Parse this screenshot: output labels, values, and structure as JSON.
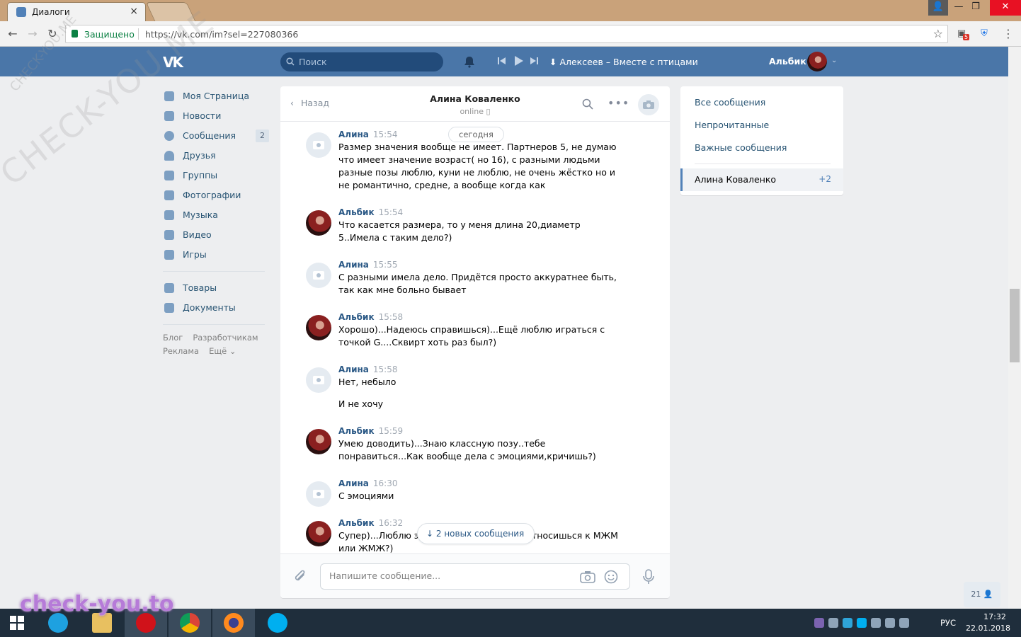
{
  "browser": {
    "tab_title": "Диалоги",
    "tab_close": "×",
    "secure_label": "Защищено",
    "url": "https://vk.com/im?sel=227080366",
    "ext_badge": "5"
  },
  "header": {
    "logo": "VK",
    "search_placeholder": "Поиск",
    "track": "Алексеев – Вместе с птицами",
    "user_name": "Альбик"
  },
  "sidebar": {
    "items": [
      {
        "label": "Моя Страница",
        "icon": "home-icon"
      },
      {
        "label": "Новости",
        "icon": "news-icon"
      },
      {
        "label": "Сообщения",
        "icon": "messages-icon",
        "count": "2"
      },
      {
        "label": "Друзья",
        "icon": "friends-icon"
      },
      {
        "label": "Группы",
        "icon": "groups-icon"
      },
      {
        "label": "Фотографии",
        "icon": "photos-icon"
      },
      {
        "label": "Музыка",
        "icon": "music-icon"
      },
      {
        "label": "Видео",
        "icon": "video-icon"
      },
      {
        "label": "Игры",
        "icon": "games-icon"
      }
    ],
    "items2": [
      {
        "label": "Товары",
        "icon": "goods-icon"
      },
      {
        "label": "Документы",
        "icon": "documents-icon"
      }
    ],
    "footer": [
      "Блог",
      "Разработчикам",
      "Реклама",
      "Ещё ⌄"
    ]
  },
  "chat": {
    "back_label": "Назад",
    "peer_name": "Алина Коваленко",
    "peer_status": "online",
    "date_pill": "сегодня",
    "new_messages": "2 новых сообщения",
    "input_placeholder": "Напишите сообщение...",
    "messages": [
      {
        "author": "Алина",
        "time": "15:54",
        "text": "Размер значения вообще не имеет. Партнеров 5, не думаю что имеет значение возраст( но 16), с разными людьми разные позы люблю, куни не люблю, не очень жёстко но и не романтично, средне, а вообще когда как"
      },
      {
        "author": "Альбик",
        "time": "15:54",
        "text": "Что касается размера, то у меня длина 20,диаметр 5..Имела с таким дело?)"
      },
      {
        "author": "Алина",
        "time": "15:55",
        "text": "С разными имела дело. Придётся просто аккуратнее быть, так как мне больно бывает"
      },
      {
        "author": "Альбик",
        "time": "15:58",
        "text": "Хорошо)...Надеюсь справишься)...Ещё люблю играться с точкой G....Сквирт хоть раз был?)"
      },
      {
        "author": "Алина",
        "time": "15:58",
        "text": "Нет, небыло",
        "text2": "И не хочу"
      },
      {
        "author": "Альбик",
        "time": "15:59",
        "text": "Умею доводить)...Знаю классную позу..тебе понравиться...Как вообще дела с эмоциями,кричишь?)"
      },
      {
        "author": "Алина",
        "time": "16:30",
        "text": "С эмоциями"
      },
      {
        "author": "Альбик",
        "time": "16:32",
        "text": "Супер)...Люблю эмоции...Кстати как ты относишься к МЖМ или ЖМЖ?)"
      }
    ]
  },
  "right_menu": {
    "all": "Все сообщения",
    "unread": "Непрочитанные",
    "important": "Важные сообщения",
    "active_name": "Алина Коваленко",
    "active_count": "+2"
  },
  "online_count": "21",
  "taskbar": {
    "lang": "РУС",
    "time": "17:32",
    "date": "22.01.2018"
  },
  "watermarks": {
    "big": "CHECK-YOU.ME",
    "corner": "CHECK-YOU.ME",
    "bottom": "check-you.to"
  },
  "colors": {
    "vk_blue": "#4a76a8",
    "link": "#2a5885"
  }
}
